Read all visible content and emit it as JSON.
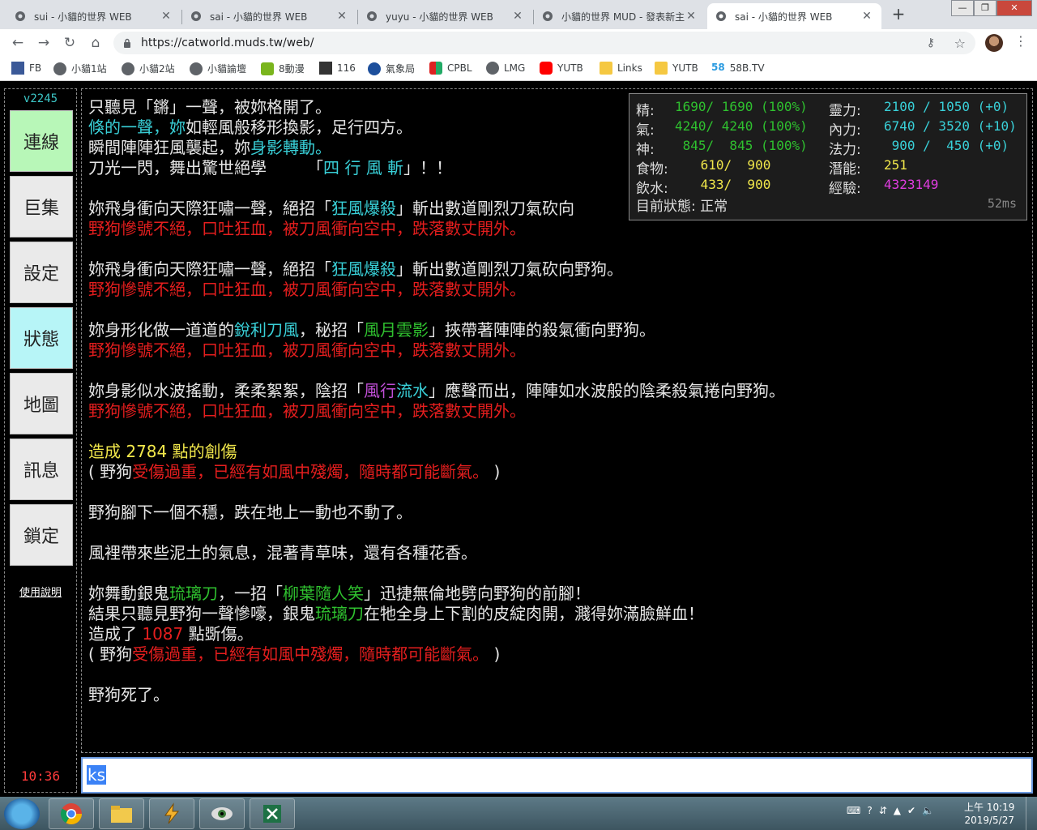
{
  "browser": {
    "tabs": [
      {
        "title": "sui - 小貓的世界 WEB",
        "active": false
      },
      {
        "title": "sai - 小貓的世界 WEB",
        "active": false
      },
      {
        "title": "yuyu - 小貓的世界 WEB",
        "active": false
      },
      {
        "title": "小貓的世界 MUD - 發表新主",
        "active": false
      },
      {
        "title": "sai - 小貓的世界 WEB",
        "active": true
      }
    ],
    "url": "https://catworld.muds.tw/web/",
    "bookmarks": [
      "FB",
      "小貓1站",
      "小貓2站",
      "小貓論壇",
      "8動漫",
      "116",
      "氣象局",
      "CPBL",
      "LMG",
      "YUTB",
      "Links",
      "YUTB",
      "58B.TV"
    ]
  },
  "sidebar": {
    "version": "v2245",
    "buttons": [
      "連線",
      "巨集",
      "設定",
      "狀態",
      "地圖",
      "訊息",
      "鎖定"
    ],
    "help": "使用說明",
    "clock": "10:36"
  },
  "stats": {
    "jing_label": "精:",
    "jing": "1690/ 1690 (100%)",
    "qi_label": "氣:",
    "qi": "4240/ 4240 (100%)",
    "shen_label": "神:",
    "shen": " 845/  845 (100%)",
    "food_label": "食物:",
    "food": " 610/  900",
    "water_label": "飲水:",
    "water": " 433/  900",
    "lingli_label": "靈力:",
    "lingli": "2100 / 1050 (+0)",
    "neili_label": "內力:",
    "neili": "6740 / 3520 (+10)",
    "fali_label": "法力:",
    "fali": " 900 /  450 (+0)",
    "qianneng_label": "潛能:",
    "qianneng": "251",
    "jingyan_label": "經驗:",
    "jingyan": "4323149",
    "state_label": "目前狀態:",
    "state": "正常",
    "ping": "52ms"
  },
  "output": [
    [
      [
        "只聽見「鏘」一聲，被妳格開了。",
        "white"
      ]
    ],
    [
      [
        "倏的一聲，妳",
        "cyan"
      ],
      [
        "如輕風般移形換影，足行四方。",
        "white"
      ]
    ],
    [
      [
        "瞬間陣陣狂風襲起，妳",
        "white"
      ],
      [
        "身影轉動。",
        "cyan"
      ]
    ],
    [
      [
        "刀光一閃，舞出驚世絕學　　　「",
        "white"
      ],
      [
        "四 行 風 斬",
        "cyan"
      ],
      [
        "」！！",
        "white"
      ]
    ],
    [],
    [
      [
        "妳飛身衝向天際狂嘯一聲，絕招「",
        "white"
      ],
      [
        "狂風爆殺",
        "cyan"
      ],
      [
        "」斬出數道剛烈刀氣砍向",
        "white"
      ]
    ],
    [
      [
        "野狗慘號不絕，口吐狂血，被刀風衝向空中，跌落數丈開外。",
        "red"
      ]
    ],
    [],
    [
      [
        "妳飛身衝向天際狂嘯一聲，絕招「",
        "white"
      ],
      [
        "狂風爆殺",
        "cyan"
      ],
      [
        "」斬出數道剛烈刀氣砍向野狗。",
        "white"
      ]
    ],
    [
      [
        "野狗慘號不絕，口吐狂血，被刀風衝向空中，跌落數丈開外。",
        "red"
      ]
    ],
    [],
    [
      [
        "妳身形化做一道道的",
        "white"
      ],
      [
        "銳利刀風",
        "cyan"
      ],
      [
        "，秘招「",
        "white"
      ],
      [
        "風月雲影",
        "green"
      ],
      [
        "」挾帶著陣陣的殺氣衝向野狗。",
        "white"
      ]
    ],
    [
      [
        "野狗慘號不絕，口吐狂血，被刀風衝向空中，跌落數丈開外。",
        "red"
      ]
    ],
    [],
    [
      [
        "妳身影似水波搖動，柔柔絮絮，陰招「",
        "white"
      ],
      [
        "風行",
        "purple"
      ],
      [
        "流水",
        "cyan"
      ],
      [
        "」應聲而出，陣陣如水波般的陰柔殺氣捲向野狗。",
        "white"
      ]
    ],
    [
      [
        "野狗慘號不絕，口吐狂血，被刀風衝向空中，跌落數丈開外。",
        "red"
      ]
    ],
    [],
    [
      [
        "造成 2784 點的創傷",
        "yellow"
      ]
    ],
    [
      [
        "( 野狗",
        "white"
      ],
      [
        "受傷過重，已經有如風中殘燭，隨時都可能斷氣。",
        "red"
      ],
      [
        " )",
        "white"
      ]
    ],
    [],
    [
      [
        "野狗腳下一個不穩，跌在地上一動也不動了。",
        "white"
      ]
    ],
    [],
    [
      [
        "風裡帶來些泥土的氣息，混著青草味，還有各種花香。",
        "white"
      ]
    ],
    [],
    [
      [
        "妳舞動銀鬼",
        "white"
      ],
      [
        "琉璃刀",
        "green"
      ],
      [
        "，一招「",
        "white"
      ],
      [
        "柳葉隨人笑",
        "green"
      ],
      [
        "」迅捷無倫地劈向野狗的前腳！",
        "white"
      ]
    ],
    [
      [
        "結果只聽見野狗一聲慘嚎，銀鬼",
        "white"
      ],
      [
        "琉璃刀",
        "green"
      ],
      [
        "在牠全身上下割的皮綻肉開，濺得妳滿臉鮮血！",
        "white"
      ]
    ],
    [
      [
        "造成了 ",
        "white"
      ],
      [
        "1087",
        "red"
      ],
      [
        " 點斲傷。",
        "white"
      ]
    ],
    [
      [
        "( 野狗",
        "white"
      ],
      [
        "受傷過重，已經有如風中殘燭，隨時都可能斷氣。",
        "red"
      ],
      [
        " )",
        "white"
      ]
    ],
    [],
    [
      [
        "野狗死了。",
        "white"
      ]
    ]
  ],
  "input": {
    "value": "ks"
  },
  "taskbar": {
    "time": "上午 10:19",
    "date": "2019/5/27"
  },
  "colors": {
    "cyan": "#39d0d8",
    "red": "#e51e1e",
    "green": "#2fc12f",
    "yellow": "#f2e84b",
    "purple": "#c04ed6"
  }
}
